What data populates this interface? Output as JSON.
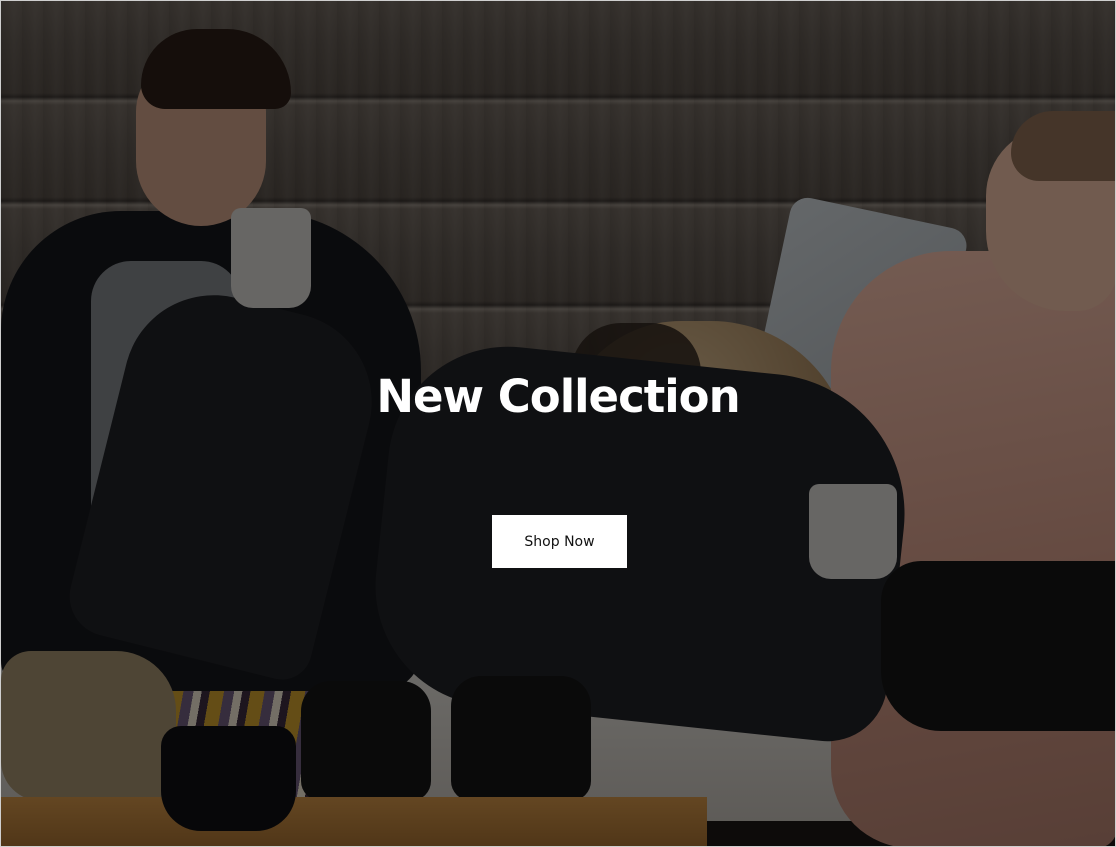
{
  "hero": {
    "title": "New Collection",
    "cta_label": "Shop Now",
    "background_image": "photo: couple with mugs and a pug on outdoor lounge, darkened overlay"
  },
  "colors": {
    "title_text": "#ffffff",
    "button_background": "#ffffff",
    "button_text": "#111111",
    "overlay": "rgba(0,0,0,0.5)"
  }
}
